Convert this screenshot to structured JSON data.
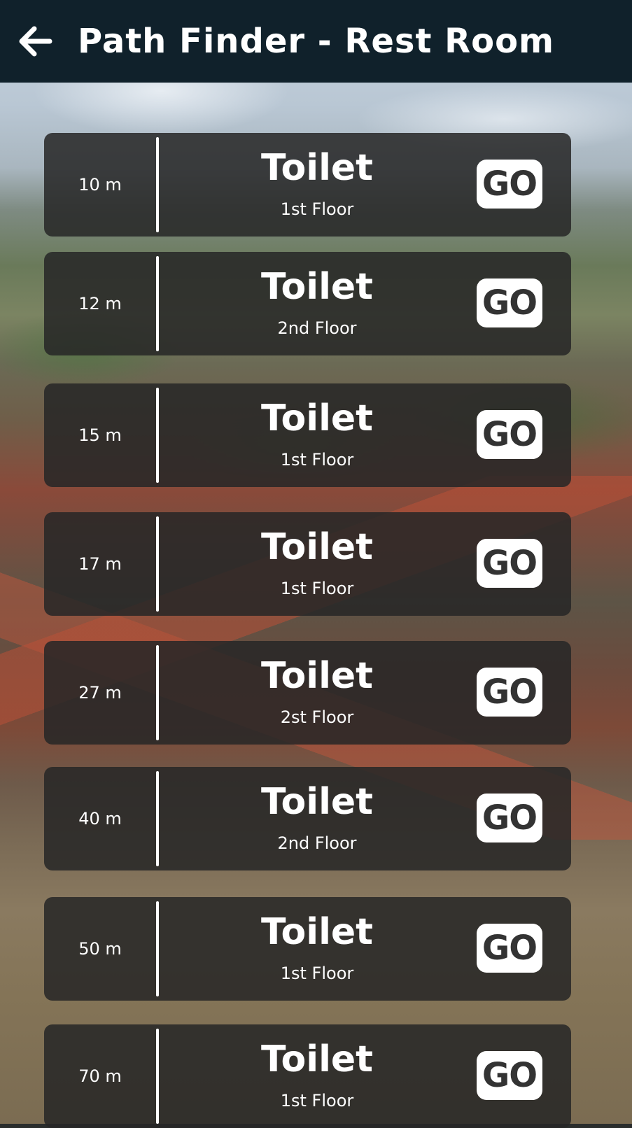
{
  "header": {
    "title": "Path Finder - Rest Room",
    "back_icon": "arrow-left-icon"
  },
  "colors": {
    "header_bg": "#10212b",
    "card_bg": "rgba(38,38,38,0.86)",
    "text": "#ffffff",
    "go_bg": "#ffffff",
    "go_text": "#333333"
  },
  "restrooms": [
    {
      "distance": "10 m",
      "name": "Toilet",
      "floor": "1st Floor",
      "action": "GO"
    },
    {
      "distance": "12 m",
      "name": "Toilet",
      "floor": "2nd Floor",
      "action": "GO"
    },
    {
      "distance": "15 m",
      "name": "Toilet",
      "floor": "1st Floor",
      "action": "GO"
    },
    {
      "distance": "17 m",
      "name": "Toilet",
      "floor": "1st Floor",
      "action": "GO"
    },
    {
      "distance": "27 m",
      "name": "Toilet",
      "floor": "2st Floor",
      "action": "GO"
    },
    {
      "distance": "40 m",
      "name": "Toilet",
      "floor": "2nd Floor",
      "action": "GO"
    },
    {
      "distance": "50 m",
      "name": "Toilet",
      "floor": "1st Floor",
      "action": "GO"
    },
    {
      "distance": "70 m",
      "name": "Toilet",
      "floor": "1st Floor",
      "action": "GO"
    }
  ]
}
